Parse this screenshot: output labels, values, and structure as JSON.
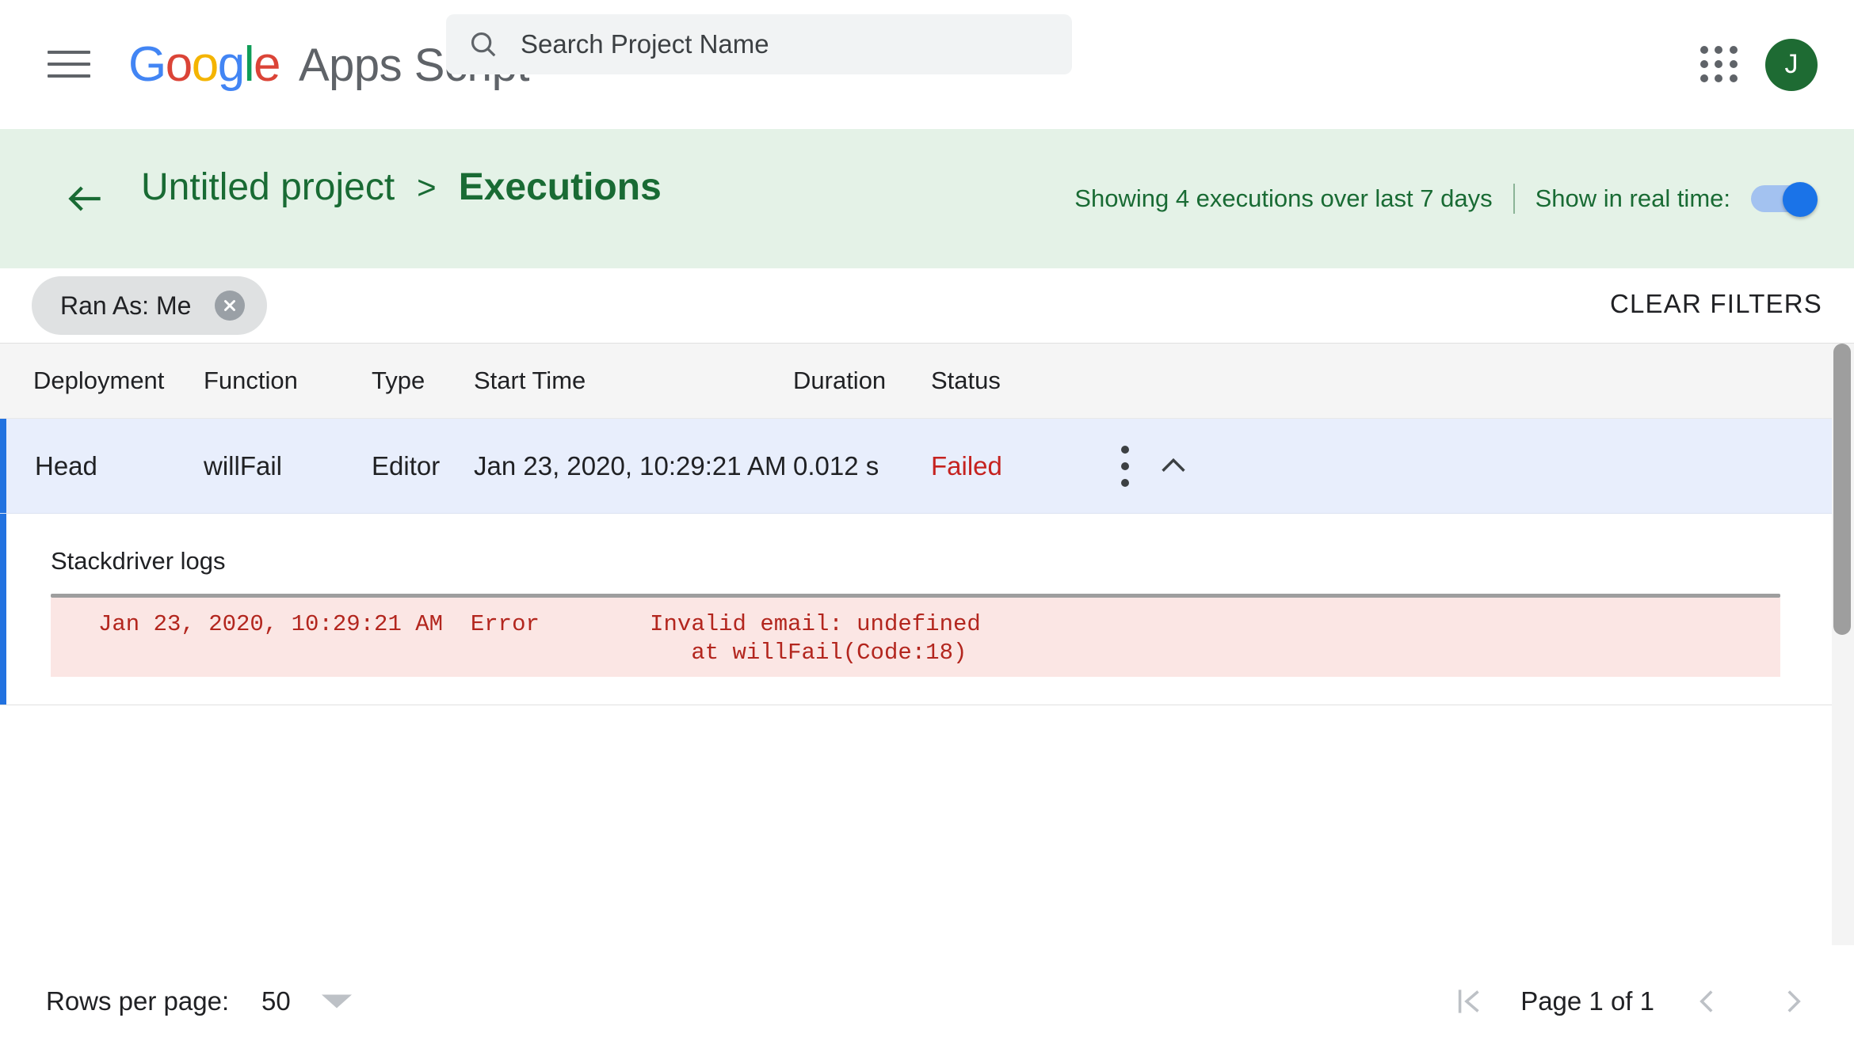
{
  "topbar": {
    "menu_label": "menu",
    "logo": {
      "g1": "G",
      "o1": "o",
      "o2": "o",
      "g2": "g",
      "l": "l",
      "e": "e"
    },
    "product_name": "Apps Script",
    "search": {
      "placeholder": "Search Project Name",
      "value": ""
    },
    "apps_label": "Google apps",
    "avatar_initial": "J"
  },
  "banner": {
    "back_label": "Back",
    "project_name": "Untitled project",
    "separator": ">",
    "current_page": "Executions",
    "showing_text": "Showing 4 executions over last 7 days",
    "divider": "|",
    "realtime_label": "Show in real time:",
    "realtime_on": true
  },
  "filters": {
    "chips": [
      {
        "label": "Ran As: Me"
      }
    ],
    "clear_label": "CLEAR FILTERS"
  },
  "table": {
    "columns": [
      "Deployment",
      "Function",
      "Type",
      "Start Time",
      "Duration",
      "Status"
    ],
    "rows": [
      {
        "deployment": "Head",
        "function": "willFail",
        "type": "Editor",
        "start_time": "Jan 23, 2020, 10:29:21 AM",
        "duration": "0.012 s",
        "status": "Failed",
        "selected": true,
        "expanded": true
      }
    ]
  },
  "detail": {
    "title": "Stackdriver logs",
    "log_line_1": "Jan 23, 2020, 10:29:21 AM  Error        Invalid email: undefined",
    "log_line_2": "                                           at willFail(Code:18)"
  },
  "footer": {
    "rows_per_page_label": "Rows per page:",
    "rows_per_page_value": "50",
    "page_text": "Page 1 of 1",
    "first_page_label": "First page",
    "prev_page_label": "Previous page",
    "next_page_label": "Next page"
  },
  "colors": {
    "banner_bg": "#e4f2e7",
    "banner_text": "#196b34",
    "accent_blue": "#1a73e8",
    "row_selected_bg": "#e8eefc",
    "status_failed": "#c5221f",
    "log_bg": "#fbe6e4",
    "log_text": "#b3261e",
    "avatar_bg": "#1e6b33"
  }
}
